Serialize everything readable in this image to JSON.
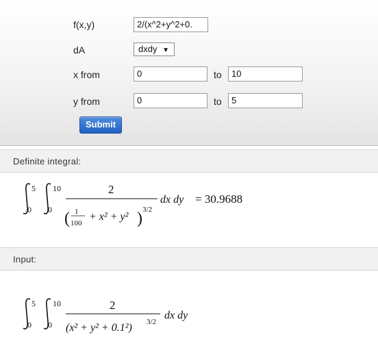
{
  "form": {
    "function_label": "f(x,y)",
    "function_value": "2/(x^2+y^2+0.",
    "da_label": "dA",
    "da_value": "dxdy",
    "da_arrow": "▼",
    "x_from_label": "x from",
    "x_from_value": "0",
    "x_to_label": "to",
    "x_to_value": "10",
    "y_from_label": "y from",
    "y_from_value": "0",
    "y_to_label": "to",
    "y_to_value": "5",
    "submit_label": "Submit"
  },
  "result": {
    "header": "Definite integral:",
    "outer_upper": "5",
    "outer_lower": "0",
    "inner_upper": "10",
    "inner_lower": "0",
    "numerator": "2",
    "frac_num": "1",
    "frac_den": "100",
    "denominator_rest": "+ x² + y²",
    "exponent": "3/2",
    "differentials": "dx dy",
    "equals": "= 30.9688"
  },
  "input": {
    "header": "Input:",
    "outer_upper": "5",
    "outer_lower": "0",
    "inner_upper": "10",
    "inner_lower": "0",
    "numerator": "2",
    "denominator": "(x² + y² + 0.1²)",
    "exponent": "3/2",
    "differentials": "dx dy"
  }
}
